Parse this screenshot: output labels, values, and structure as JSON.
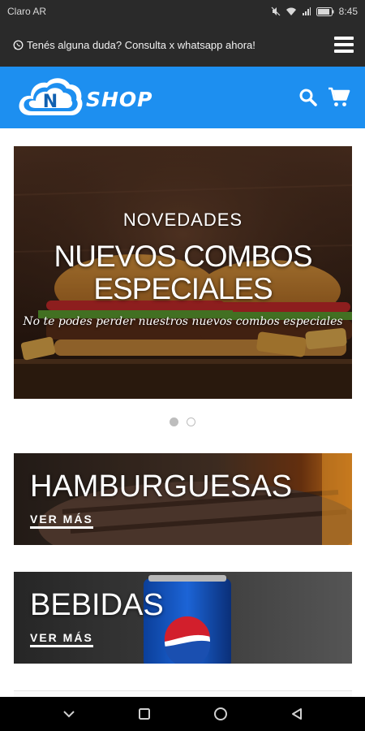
{
  "status_bar": {
    "carrier": "Claro AR",
    "time": "8:45"
  },
  "notice": {
    "icon": "whatsapp-icon",
    "text": "Tenés alguna duda? Consulta x whatsapp ahora!"
  },
  "header": {
    "logo_letter": "N",
    "logo_text": "SHOP",
    "accent_color": "#1d8ff0"
  },
  "carousel": {
    "kicker": "NOVEDADES",
    "title": "NUEVOS COMBOS ESPECIALES",
    "subtitle": "No te podes perder nuestros nuevos combos especiales",
    "slide_count": 2,
    "active_slide": 1
  },
  "categories": [
    {
      "title": "HAMBURGUESAS",
      "link_label": "VER MÁS"
    },
    {
      "title": "BEBIDAS",
      "link_label": "VER MÁS"
    }
  ]
}
